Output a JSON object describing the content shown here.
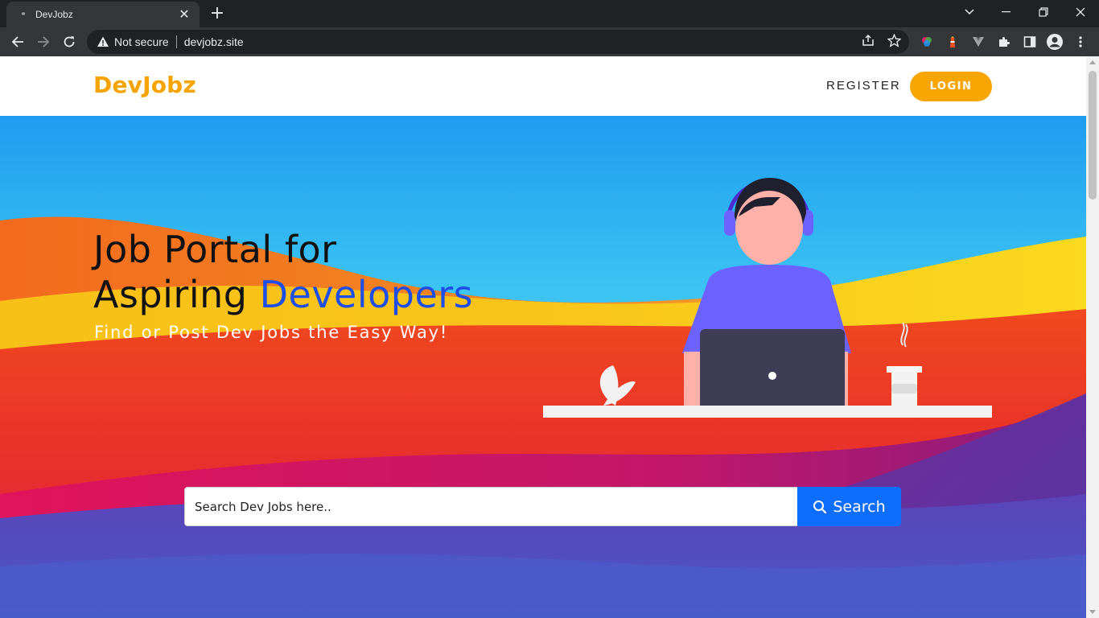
{
  "browser": {
    "tab_title": "DevJobz",
    "new_tab_symbol": "+",
    "security_label": "Not secure",
    "url": "devjobz.site"
  },
  "nav": {
    "brand": "DevJobz",
    "register_label": "REGISTER",
    "login_label": "LOGIN"
  },
  "hero": {
    "headline_line1": "Job Portal for",
    "headline_line2_prefix": "Aspiring ",
    "headline_line2_accent": "Developers",
    "tagline": "Find or Post Dev Jobs the Easy Way!"
  },
  "search": {
    "placeholder": "Search Dev Jobs here..",
    "button_label": "Search"
  },
  "colors": {
    "brand": "#f7a400",
    "login_bg": "#f9a602",
    "accent": "#1d4ee8",
    "search_button": "#0d6efd"
  }
}
